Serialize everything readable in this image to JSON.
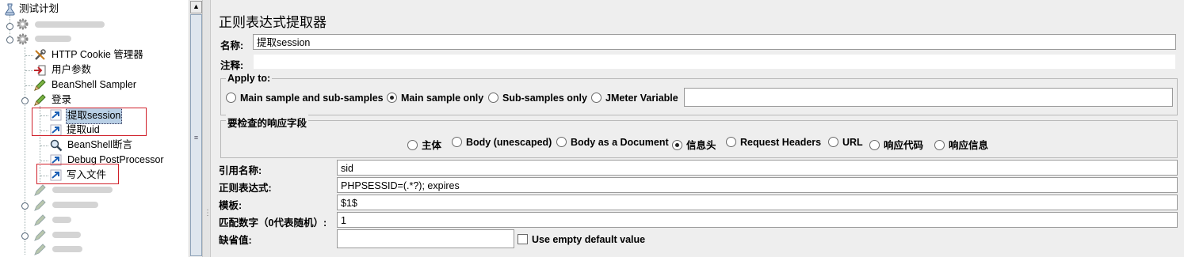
{
  "tree": {
    "nodes": [
      {
        "label": "测试计划"
      },
      {
        "label": "HTTP Cookie 管理器"
      },
      {
        "label": "用户参数"
      },
      {
        "label": "BeanShell Sampler"
      },
      {
        "label": "登录"
      },
      {
        "label": "提取session"
      },
      {
        "label": "提取uid"
      },
      {
        "label": "BeanShell断言"
      },
      {
        "label": "Debug PostProcessor"
      },
      {
        "label": "写入文件"
      }
    ]
  },
  "editor": {
    "title": "正则表达式提取器",
    "name_label": "名称:",
    "name_value": "提取session",
    "comment_label": "注释:",
    "comment_value": "",
    "apply_to": {
      "title": "Apply to:",
      "options": [
        "Main sample and sub-samples",
        "Main sample only",
        "Sub-samples only",
        "JMeter Variable"
      ],
      "selected": 1,
      "variable_value": ""
    },
    "field_check": {
      "title": "要检查的响应字段",
      "options": [
        "主体",
        "Body (unescaped)",
        "Body as a Document",
        "信息头",
        "Request Headers",
        "URL",
        "响应代码",
        "响应信息"
      ],
      "selected": 3
    },
    "ref_name_label": "引用名称:",
    "ref_name_value": "sid",
    "regex_label": "正则表达式:",
    "regex_value": "PHPSESSID=(.*?); expires",
    "template_label": "模板:",
    "template_value": "$1$",
    "match_no_label": "匹配数字（0代表随机）:",
    "match_no_value": "1",
    "default_label": "缺省值:",
    "default_value": "",
    "use_empty_label": "Use empty default value",
    "use_empty_checked": false
  },
  "colors": {
    "highlight_box": "#d0202a",
    "selection": "#b8cfe5"
  },
  "icons": [
    "flask-icon",
    "gear-icon",
    "wrench-icon",
    "arrow-in-icon",
    "pencil-icon",
    "blue-arrow-icon",
    "magnifier-icon"
  ]
}
